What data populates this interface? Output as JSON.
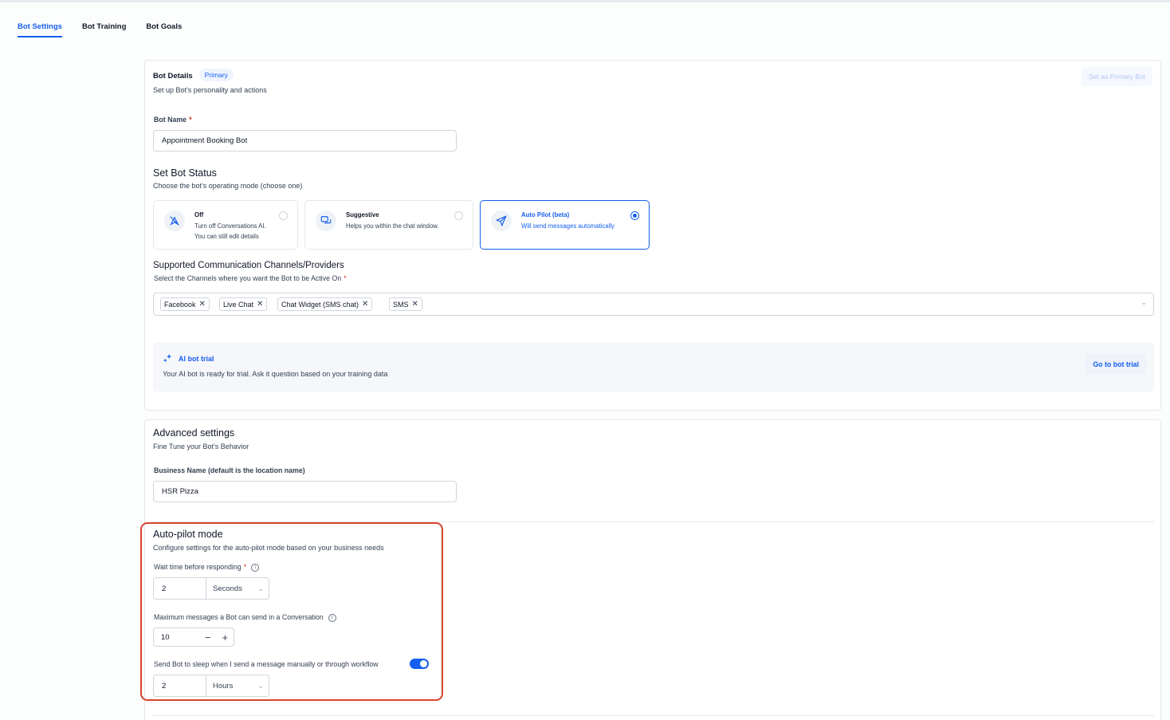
{
  "tabs": [
    "Bot Settings",
    "Bot Training",
    "Bot Goals"
  ],
  "bot_details": {
    "title": "Bot Details",
    "badge": "Primary",
    "subtitle": "Set up Bot's personality and actions",
    "set_primary_label": "Set as Primary Bot",
    "bot_name_label": "Bot Name",
    "required_mark": "*",
    "bot_name_value": "Appointment Booking Bot"
  },
  "status": {
    "title": "Set Bot Status",
    "subtitle": "Choose the bot's operating mode (choose one)",
    "options": [
      {
        "title": "Off",
        "line1": "Turn off Conversations AI.",
        "line2": "You can still edit details"
      },
      {
        "title": "Suggestive",
        "line1": "Helps you within the chat window.",
        "line2": ""
      },
      {
        "title": "Auto Pilot (beta)",
        "line1": "Will send messages automatically",
        "line2": ""
      }
    ],
    "selected": "Auto Pilot (beta)"
  },
  "channels": {
    "title": "Supported Communication Channels/Providers",
    "label": "Select the Channels where you want the Bot to be Active On",
    "selected": [
      "Facebook",
      "Live Chat",
      "Chat Widget (SMS chat)",
      "SMS"
    ],
    "remove_glyph": "✕",
    "dropdown_glyph": "⌄"
  },
  "trial": {
    "title": "AI bot trial",
    "description": "Your AI bot is ready for trial. Ask it question based on your training data",
    "button": "Go to bot trial"
  },
  "advanced": {
    "title": "Advanced settings",
    "subtitle": "Fine Tune your Bot's Behavior",
    "business_label": "Business Name (default is the location name)",
    "business_value": "HSR Pizza"
  },
  "autopilot": {
    "title": "Auto-pilot mode",
    "subtitle": "Configure settings for the auto-pilot mode based on your business needs",
    "wait_label": "Wait time before responding",
    "wait_value": "2",
    "wait_unit": "Seconds",
    "max_label": "Maximum messages a Bot can send in a Conversation",
    "max_value": "10",
    "minus": "−",
    "plus": "+",
    "sleep_label": "Send Bot to sleep when I send a message manually or through workflow",
    "sleep_enabled": true,
    "sleep_value": "2",
    "sleep_unit": "Hours",
    "info_glyph": "i",
    "chevron_glyph": "⌄"
  },
  "colors": {
    "accent": "#155eef",
    "highlight": "#d9432f"
  }
}
